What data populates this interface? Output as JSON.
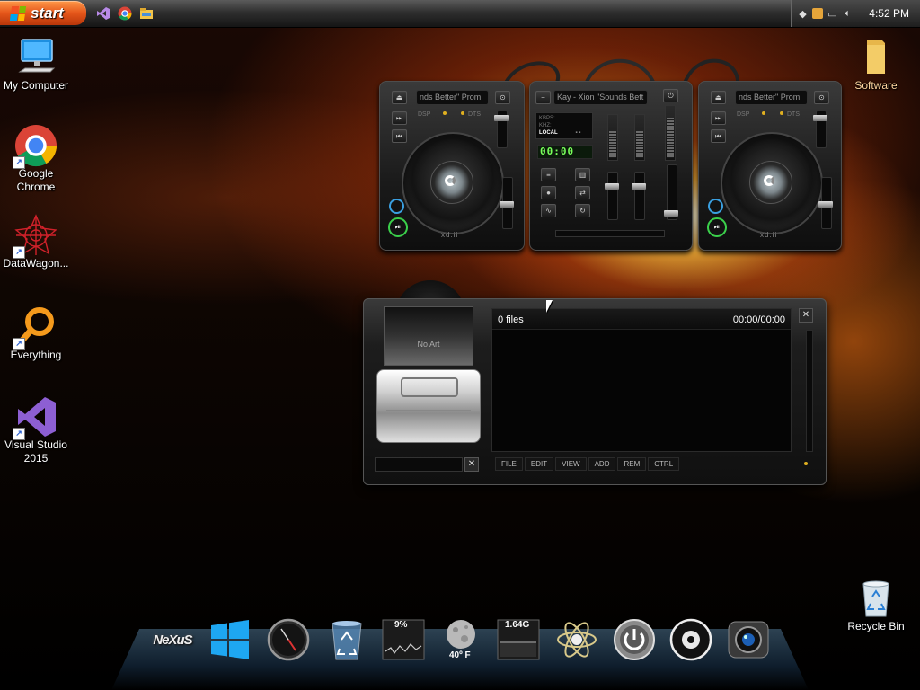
{
  "taskbar": {
    "start_label": "start",
    "quick_launch": [
      {
        "icon": "visual-studio-icon"
      },
      {
        "icon": "chrome-icon"
      },
      {
        "icon": "file-explorer-icon"
      }
    ],
    "tray_icons": [
      "network-icon",
      "folder-flag-icon",
      "monitor-network-icon",
      "volume-icon"
    ],
    "clock": "4:52 PM"
  },
  "desktop_icons": [
    {
      "label": "My Computer",
      "icon": "monitor-icon"
    },
    {
      "label": "Google Chrome",
      "icon": "chrome-icon"
    },
    {
      "label": "DataWagon...",
      "icon": "datawagon-icon"
    },
    {
      "label": "Everything",
      "icon": "magnifier-icon"
    },
    {
      "label": "Visual Studio 2015",
      "icon": "visual-studio-icon"
    },
    {
      "label": "Software",
      "icon": "folder-icon"
    },
    {
      "label": "Recycle Bin",
      "icon": "recycle-bin-icon"
    }
  ],
  "dj": {
    "deck_left_title": "nds Better\" Prom",
    "deck_right_title": "nds Better\" Prom",
    "mixer_title": "Kay - Xion \"Sounds Bett",
    "mixer_info": [
      "KBPS:",
      "KHZ:",
      "LOCAL"
    ],
    "mixer_info_dash": "- -",
    "lcd": "00:00",
    "deck_logo": "xd.ii",
    "dsp_label": "DSP",
    "dts_label": "DTS"
  },
  "player": {
    "no_art": "No Art",
    "file_count": "0 files",
    "time": "00:00/00:00",
    "menu": [
      "FILE",
      "EDIT",
      "VIEW",
      "ADD",
      "REM",
      "CTRL"
    ]
  },
  "dock": {
    "items": [
      {
        "icon": "nexus-logo-icon",
        "label": "NeXuS"
      },
      {
        "icon": "windows-logo-icon"
      },
      {
        "icon": "clock-icon"
      },
      {
        "icon": "recycle-bin-icon"
      },
      {
        "icon": "cpu-meter-icon",
        "label": "9%"
      },
      {
        "icon": "weather-moon-icon",
        "label": "40º F"
      },
      {
        "icon": "memory-meter-icon",
        "label": "1.64G"
      },
      {
        "icon": "atom-icon"
      },
      {
        "icon": "power-icon"
      },
      {
        "icon": "media-player-icon"
      },
      {
        "icon": "camera-icon"
      }
    ]
  },
  "colors": {
    "start_orange": "#e5561a",
    "lcd_green": "#78ff5a",
    "play_green": "#3bd04b",
    "cue_blue": "#3a9fe0"
  }
}
